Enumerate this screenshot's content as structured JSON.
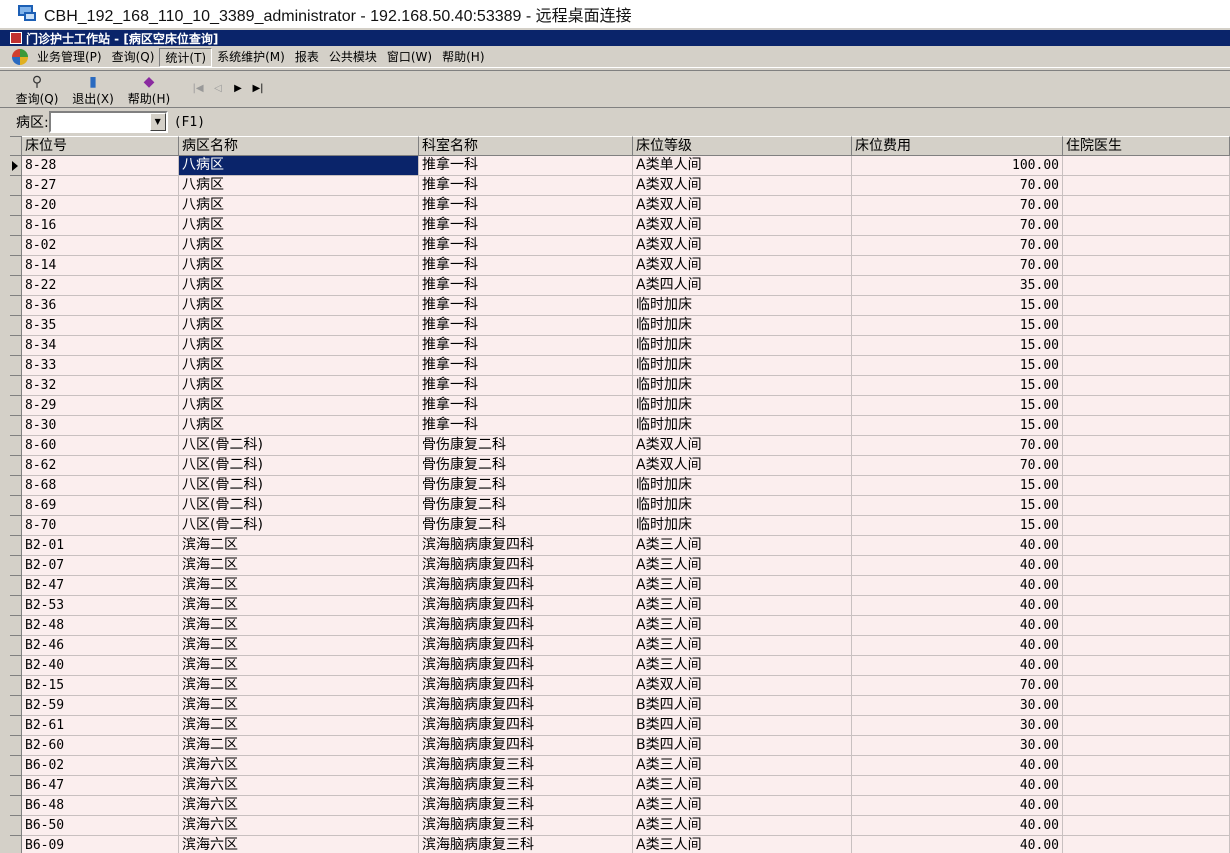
{
  "rdp": {
    "title": "CBH_192_168_110_10_3389_administrator - 192.168.50.40:53389 - 远程桌面连接"
  },
  "app": {
    "title": "门诊护士工作站 - [病区空床位查询]"
  },
  "menu": [
    "业务管理(P)",
    "查询(Q)",
    "统计(T)",
    "系统维护(M)",
    "报表",
    "公共模块",
    "窗口(W)",
    "帮助(H)"
  ],
  "toolbar": {
    "query": "查询(Q)",
    "exit": "退出(X)",
    "help": "帮助(H)"
  },
  "filter": {
    "label": "病区:",
    "value": "",
    "hint": "(F1)"
  },
  "grid": {
    "columns": [
      "床位号",
      "病区名称",
      "科室名称",
      "床位等级",
      "床位费用",
      "住院医生"
    ],
    "rows": [
      [
        "8-28",
        "八病区",
        "推拿一科",
        "A类单人间",
        "100.00",
        ""
      ],
      [
        "8-27",
        "八病区",
        "推拿一科",
        "A类双人间",
        "70.00",
        ""
      ],
      [
        "8-20",
        "八病区",
        "推拿一科",
        "A类双人间",
        "70.00",
        ""
      ],
      [
        "8-16",
        "八病区",
        "推拿一科",
        "A类双人间",
        "70.00",
        ""
      ],
      [
        "8-02",
        "八病区",
        "推拿一科",
        "A类双人间",
        "70.00",
        ""
      ],
      [
        "8-14",
        "八病区",
        "推拿一科",
        "A类双人间",
        "70.00",
        ""
      ],
      [
        "8-22",
        "八病区",
        "推拿一科",
        "A类四人间",
        "35.00",
        ""
      ],
      [
        "8-36",
        "八病区",
        "推拿一科",
        "临时加床",
        "15.00",
        ""
      ],
      [
        "8-35",
        "八病区",
        "推拿一科",
        "临时加床",
        "15.00",
        ""
      ],
      [
        "8-34",
        "八病区",
        "推拿一科",
        "临时加床",
        "15.00",
        ""
      ],
      [
        "8-33",
        "八病区",
        "推拿一科",
        "临时加床",
        "15.00",
        ""
      ],
      [
        "8-32",
        "八病区",
        "推拿一科",
        "临时加床",
        "15.00",
        ""
      ],
      [
        "8-29",
        "八病区",
        "推拿一科",
        "临时加床",
        "15.00",
        ""
      ],
      [
        "8-30",
        "八病区",
        "推拿一科",
        "临时加床",
        "15.00",
        ""
      ],
      [
        "8-60",
        "八区(骨二科)",
        "骨伤康复二科",
        "A类双人间",
        "70.00",
        ""
      ],
      [
        "8-62",
        "八区(骨二科)",
        "骨伤康复二科",
        "A类双人间",
        "70.00",
        ""
      ],
      [
        "8-68",
        "八区(骨二科)",
        "骨伤康复二科",
        "临时加床",
        "15.00",
        ""
      ],
      [
        "8-69",
        "八区(骨二科)",
        "骨伤康复二科",
        "临时加床",
        "15.00",
        ""
      ],
      [
        "8-70",
        "八区(骨二科)",
        "骨伤康复二科",
        "临时加床",
        "15.00",
        ""
      ],
      [
        "B2-01",
        "滨海二区",
        "滨海脑病康复四科",
        "A类三人间",
        "40.00",
        ""
      ],
      [
        "B2-07",
        "滨海二区",
        "滨海脑病康复四科",
        "A类三人间",
        "40.00",
        ""
      ],
      [
        "B2-47",
        "滨海二区",
        "滨海脑病康复四科",
        "A类三人间",
        "40.00",
        ""
      ],
      [
        "B2-53",
        "滨海二区",
        "滨海脑病康复四科",
        "A类三人间",
        "40.00",
        ""
      ],
      [
        "B2-48",
        "滨海二区",
        "滨海脑病康复四科",
        "A类三人间",
        "40.00",
        ""
      ],
      [
        "B2-46",
        "滨海二区",
        "滨海脑病康复四科",
        "A类三人间",
        "40.00",
        ""
      ],
      [
        "B2-40",
        "滨海二区",
        "滨海脑病康复四科",
        "A类三人间",
        "40.00",
        ""
      ],
      [
        "B2-15",
        "滨海二区",
        "滨海脑病康复四科",
        "A类双人间",
        "70.00",
        ""
      ],
      [
        "B2-59",
        "滨海二区",
        "滨海脑病康复四科",
        "B类四人间",
        "30.00",
        ""
      ],
      [
        "B2-61",
        "滨海二区",
        "滨海脑病康复四科",
        "B类四人间",
        "30.00",
        ""
      ],
      [
        "B2-60",
        "滨海二区",
        "滨海脑病康复四科",
        "B类四人间",
        "30.00",
        ""
      ],
      [
        "B6-02",
        "滨海六区",
        "滨海脑病康复三科",
        "A类三人间",
        "40.00",
        ""
      ],
      [
        "B6-47",
        "滨海六区",
        "滨海脑病康复三科",
        "A类三人间",
        "40.00",
        ""
      ],
      [
        "B6-48",
        "滨海六区",
        "滨海脑病康复三科",
        "A类三人间",
        "40.00",
        ""
      ],
      [
        "B6-50",
        "滨海六区",
        "滨海脑病康复三科",
        "A类三人间",
        "40.00",
        ""
      ],
      [
        "B6-09",
        "滨海六区",
        "滨海脑病康复三科",
        "A类三人间",
        "40.00",
        ""
      ]
    ]
  }
}
